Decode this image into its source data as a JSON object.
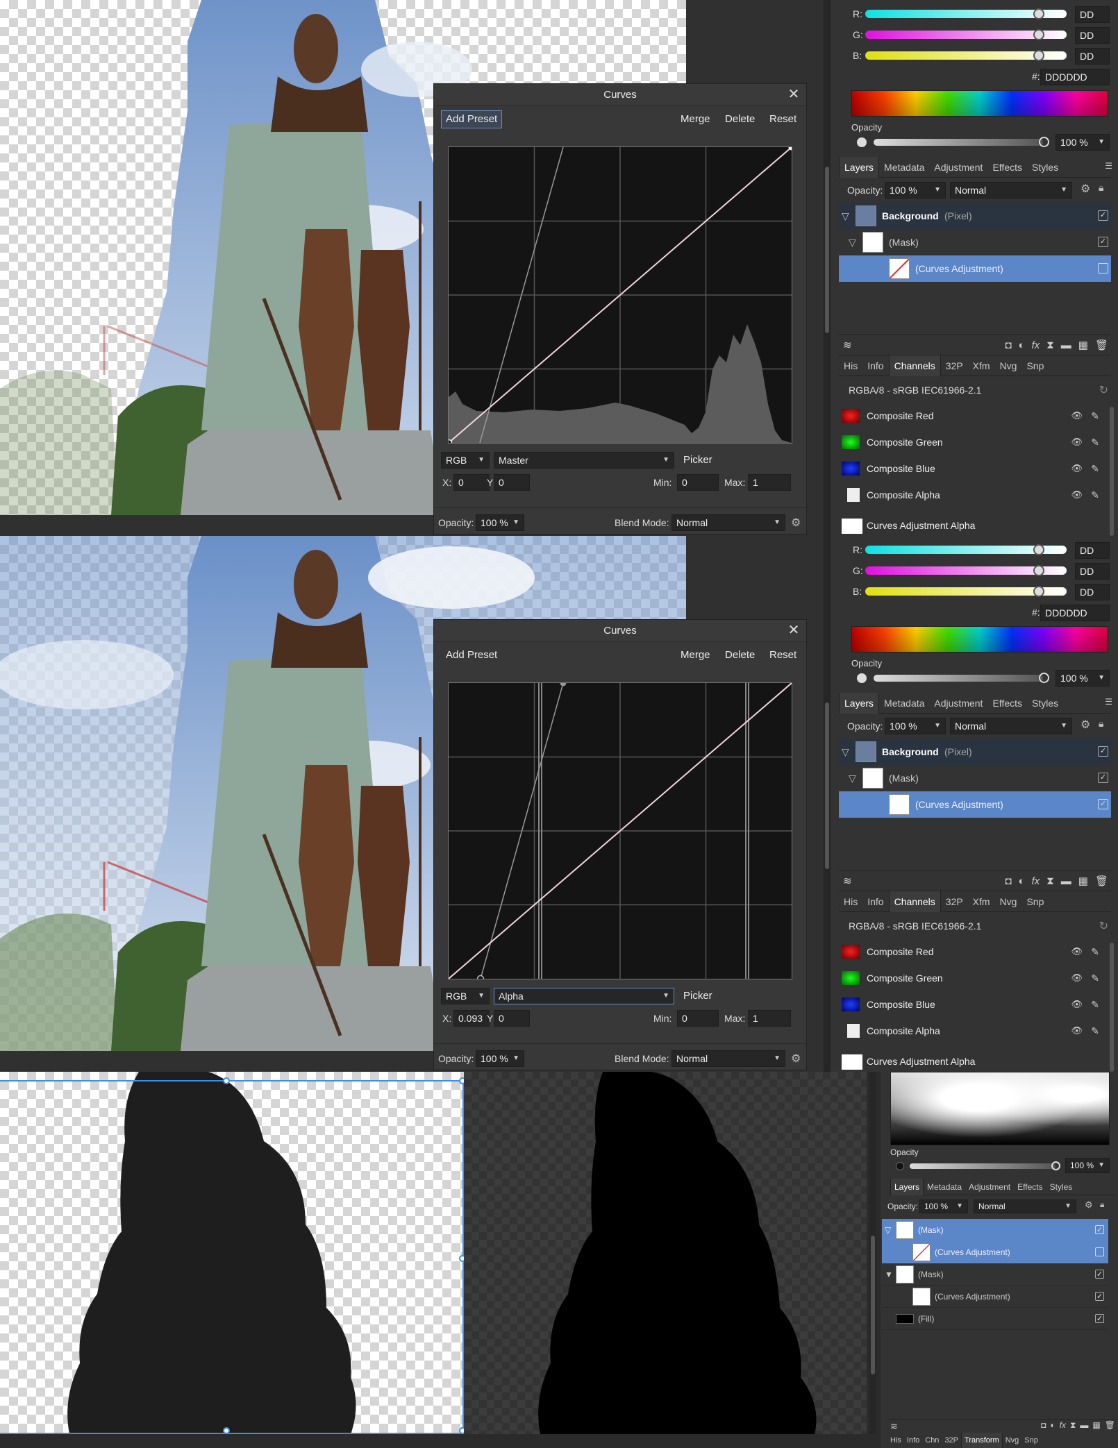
{
  "panes": [
    {
      "curves": {
        "title": "Curves",
        "add_preset": "Add Preset",
        "merge": "Merge",
        "delete": "Delete",
        "reset": "Reset",
        "channel_mode": "RGB",
        "channel": "Master",
        "picker": "Picker",
        "x_label": "X:",
        "x_value": "0",
        "y_label": "Y:",
        "y_value": "0",
        "min_label": "Min:",
        "min_value": "0",
        "max_label": "Max:",
        "max_value": "1",
        "opacity_label": "Opacity:",
        "opacity_value": "100 %",
        "blend_label": "Blend Mode:",
        "blend_value": "Normal"
      },
      "color": {
        "r_label": "R:",
        "r_value": "DD",
        "g_label": "G:",
        "g_value": "DD",
        "b_label": "B:",
        "b_value": "DD",
        "hex_label": "#:",
        "hex_value": "DDDDDD",
        "opacity_label": "Opacity",
        "opacity_value": "100 %"
      },
      "layers_tabs": [
        "Layers",
        "Metadata",
        "Adjustment",
        "Effects",
        "Styles"
      ],
      "layers_opacity_label": "Opacity:",
      "layers_opacity": "100 %",
      "layers_blend": "Normal",
      "layers": {
        "background": "Background",
        "background_kind": "(Pixel)",
        "mask": "(Mask)",
        "curves": "(Curves Adjustment)"
      },
      "channels_tabs": [
        "His",
        "Info",
        "Channels",
        "32P",
        "Xfm",
        "Nvg",
        "Snp"
      ],
      "profile": "RGBA/8 - sRGB IEC61966-2.1",
      "channels": [
        "Composite Red",
        "Composite Green",
        "Composite Blue",
        "Composite Alpha",
        "Curves Adjustment Alpha"
      ]
    },
    {
      "curves": {
        "title": "Curves",
        "add_preset": "Add Preset",
        "merge": "Merge",
        "delete": "Delete",
        "reset": "Reset",
        "channel_mode": "RGB",
        "channel": "Alpha",
        "picker": "Picker",
        "x_label": "X:",
        "x_value": "0.093",
        "y_label": "Y:",
        "y_value": "0",
        "min_label": "Min:",
        "min_value": "0",
        "max_label": "Max:",
        "max_value": "1",
        "opacity_label": "Opacity:",
        "opacity_value": "100 %",
        "blend_label": "Blend Mode:",
        "blend_value": "Normal"
      },
      "color": {
        "r_label": "R:",
        "r_value": "DD",
        "g_label": "G:",
        "g_value": "DD",
        "b_label": "B:",
        "b_value": "DD",
        "hex_label": "#:",
        "hex_value": "DDDDDD",
        "opacity_label": "Opacity",
        "opacity_value": "100 %"
      },
      "layers_tabs": [
        "Layers",
        "Metadata",
        "Adjustment",
        "Effects",
        "Styles"
      ],
      "layers_opacity_label": "Opacity:",
      "layers_opacity": "100 %",
      "layers_blend": "Normal",
      "layers": {
        "background": "Background",
        "background_kind": "(Pixel)",
        "mask": "(Mask)",
        "curves": "(Curves Adjustment)"
      },
      "channels_tabs": [
        "His",
        "Info",
        "Channels",
        "32P",
        "Xfm",
        "Nvg",
        "Snp"
      ],
      "profile": "RGBA/8 - sRGB IEC61966-2.1",
      "channels": [
        "Composite Red",
        "Composite Green",
        "Composite Blue",
        "Composite Alpha",
        "Curves Adjustment Alpha"
      ]
    }
  ],
  "bottom": {
    "opacity_label": "Opacity",
    "opacity_value": "100 %",
    "tabs": [
      "Layers",
      "Metadata",
      "Adjustment",
      "Effects",
      "Styles"
    ],
    "layers_opacity_label": "Opacity:",
    "layers_opacity": "100 %",
    "layers_blend": "Normal",
    "layers": [
      "(Mask)",
      "(Curves Adjustment)",
      "(Mask)",
      "(Curves Adjustment)",
      "(Fill)"
    ],
    "footer_tabs": [
      "His",
      "Info",
      "Chn",
      "32P",
      "Transform",
      "Nvg",
      "Snp"
    ]
  },
  "colors": {
    "selected_row": "#5b86c8",
    "curve_line": "#f2d6dc",
    "selection_outline": "#3d8ee8"
  }
}
